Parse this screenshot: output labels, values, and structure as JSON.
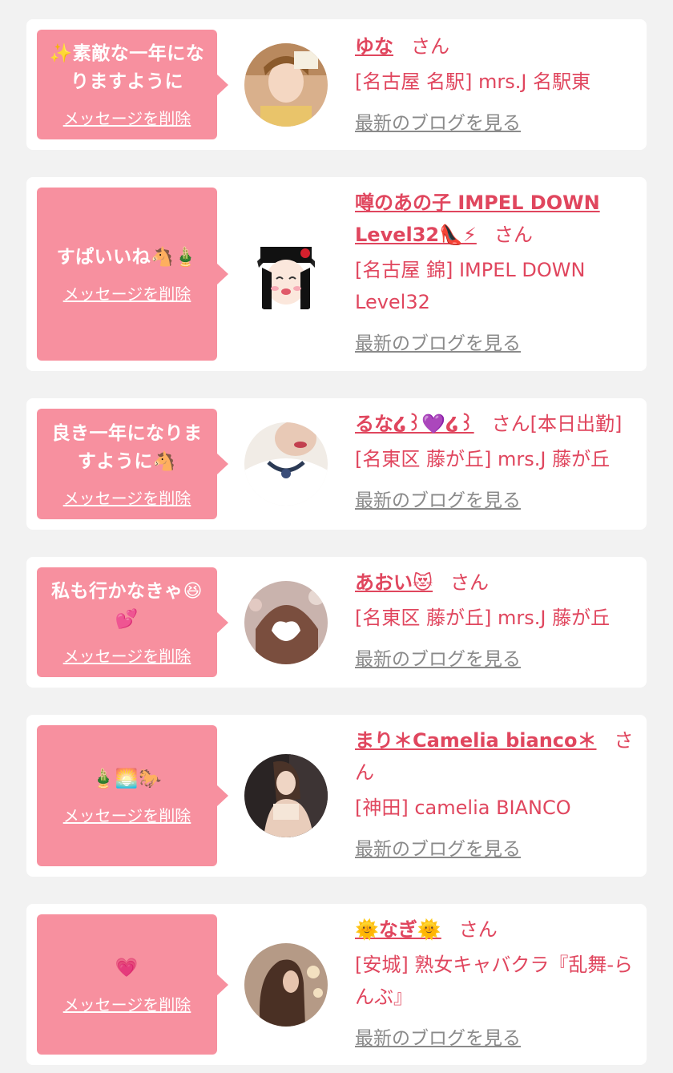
{
  "cards": [
    {
      "message": "✨素敵な一年になりますように",
      "delete_label": "メッセージを削除",
      "name": "ゆな",
      "san": "さん",
      "extra": "",
      "shop": "[名古屋 名駅] mrs.J 名駅東",
      "blog_label": "最新のブログを見る"
    },
    {
      "message": "すぱいいね🐴🎍",
      "delete_label": "メッセージを削除",
      "name": "噂のあの子 IMPEL DOWN Level32👠⚡",
      "san": "さん",
      "extra": "",
      "shop": "[名古屋 錦] IMPEL DOWN Level32",
      "blog_label": "最新のブログを見る"
    },
    {
      "message": "良き一年になりますように🐴",
      "delete_label": "メッセージを削除",
      "name": "るな໒꒱💜໒꒱",
      "san": "さん",
      "extra": "[本日出勤]",
      "shop": "[名東区 藤が丘] mrs.J 藤が丘",
      "blog_label": "最新のブログを見る"
    },
    {
      "message": "私も行かなきゃ😆💕",
      "delete_label": "メッセージを削除",
      "name": "あおい😻",
      "san": "さん",
      "extra": "",
      "shop": "[名東区 藤が丘] mrs.J 藤が丘",
      "blog_label": "最新のブログを見る"
    },
    {
      "message": "🎍🌅🐎",
      "delete_label": "メッセージを削除",
      "name": "まり＊Camelia bianco＊",
      "san": "さん",
      "extra": "",
      "shop": "[神田] camelia BIANCO",
      "blog_label": "最新のブログを見る"
    },
    {
      "message": "💗",
      "delete_label": "メッセージを削除",
      "name": "🌞なぎ🌞",
      "san": "さん",
      "extra": "",
      "shop": "[安城] 熟女キャバクラ『乱舞-らんぶ』",
      "blog_label": "最新のブログを見る"
    }
  ],
  "colors": {
    "page_bg": "#f2f2f2",
    "bubble": "#f7909f",
    "accent": "#e0465e",
    "muted_link": "#8a8a8a"
  },
  "icons": [
    "user-avatar-photo"
  ]
}
